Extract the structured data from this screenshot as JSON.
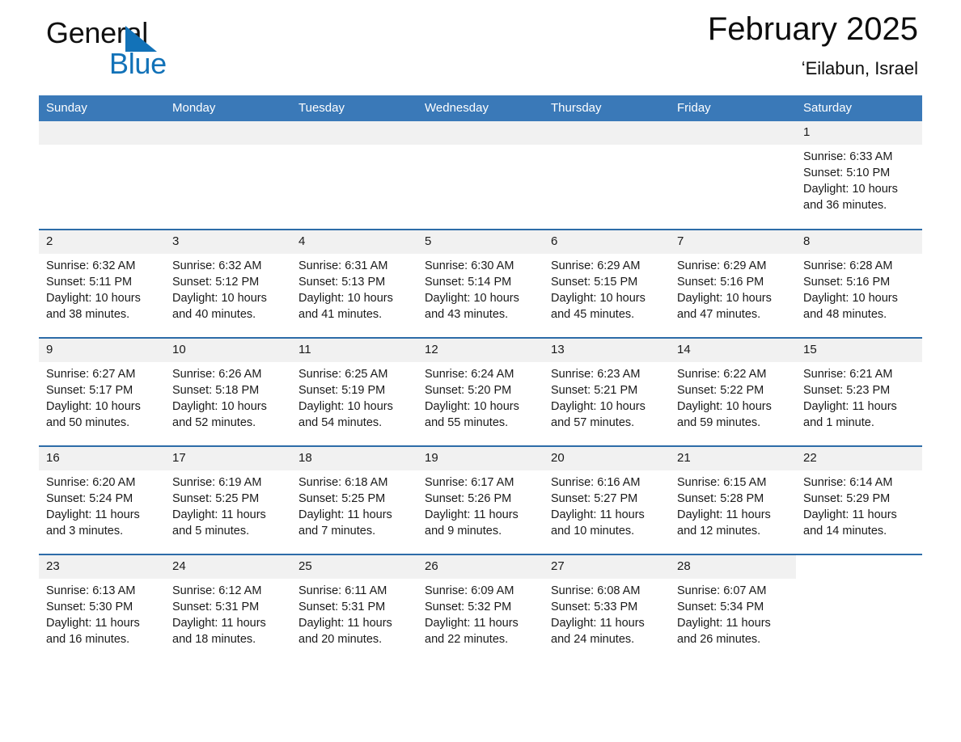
{
  "brand": {
    "word_one": "General",
    "word_two": "Blue",
    "triangle_icon": "brand-triangle-icon",
    "accent_color": "#1272b8"
  },
  "header": {
    "title": "February 2025",
    "subtitle": "ʻEilabun, Israel"
  },
  "theme": {
    "header_row_bg": "#3a79b8",
    "week_divider": "#2d6ca8",
    "daynum_bg": "#f1f1f1",
    "text": "#1a1a1a"
  },
  "weekday_headers": [
    "Sunday",
    "Monday",
    "Tuesday",
    "Wednesday",
    "Thursday",
    "Friday",
    "Saturday"
  ],
  "labels": {
    "sunrise_prefix": "Sunrise:",
    "sunset_prefix": "Sunset:",
    "daylight_prefix": "Daylight:"
  },
  "weeks": [
    [
      {
        "day": "",
        "sunrise": "",
        "sunset": "",
        "daylight": ""
      },
      {
        "day": "",
        "sunrise": "",
        "sunset": "",
        "daylight": ""
      },
      {
        "day": "",
        "sunrise": "",
        "sunset": "",
        "daylight": ""
      },
      {
        "day": "",
        "sunrise": "",
        "sunset": "",
        "daylight": ""
      },
      {
        "day": "",
        "sunrise": "",
        "sunset": "",
        "daylight": ""
      },
      {
        "day": "",
        "sunrise": "",
        "sunset": "",
        "daylight": ""
      },
      {
        "day": "1",
        "sunrise": "Sunrise: 6:33 AM",
        "sunset": "Sunset: 5:10 PM",
        "daylight": "Daylight: 10 hours and 36 minutes."
      }
    ],
    [
      {
        "day": "2",
        "sunrise": "Sunrise: 6:32 AM",
        "sunset": "Sunset: 5:11 PM",
        "daylight": "Daylight: 10 hours and 38 minutes."
      },
      {
        "day": "3",
        "sunrise": "Sunrise: 6:32 AM",
        "sunset": "Sunset: 5:12 PM",
        "daylight": "Daylight: 10 hours and 40 minutes."
      },
      {
        "day": "4",
        "sunrise": "Sunrise: 6:31 AM",
        "sunset": "Sunset: 5:13 PM",
        "daylight": "Daylight: 10 hours and 41 minutes."
      },
      {
        "day": "5",
        "sunrise": "Sunrise: 6:30 AM",
        "sunset": "Sunset: 5:14 PM",
        "daylight": "Daylight: 10 hours and 43 minutes."
      },
      {
        "day": "6",
        "sunrise": "Sunrise: 6:29 AM",
        "sunset": "Sunset: 5:15 PM",
        "daylight": "Daylight: 10 hours and 45 minutes."
      },
      {
        "day": "7",
        "sunrise": "Sunrise: 6:29 AM",
        "sunset": "Sunset: 5:16 PM",
        "daylight": "Daylight: 10 hours and 47 minutes."
      },
      {
        "day": "8",
        "sunrise": "Sunrise: 6:28 AM",
        "sunset": "Sunset: 5:16 PM",
        "daylight": "Daylight: 10 hours and 48 minutes."
      }
    ],
    [
      {
        "day": "9",
        "sunrise": "Sunrise: 6:27 AM",
        "sunset": "Sunset: 5:17 PM",
        "daylight": "Daylight: 10 hours and 50 minutes."
      },
      {
        "day": "10",
        "sunrise": "Sunrise: 6:26 AM",
        "sunset": "Sunset: 5:18 PM",
        "daylight": "Daylight: 10 hours and 52 minutes."
      },
      {
        "day": "11",
        "sunrise": "Sunrise: 6:25 AM",
        "sunset": "Sunset: 5:19 PM",
        "daylight": "Daylight: 10 hours and 54 minutes."
      },
      {
        "day": "12",
        "sunrise": "Sunrise: 6:24 AM",
        "sunset": "Sunset: 5:20 PM",
        "daylight": "Daylight: 10 hours and 55 minutes."
      },
      {
        "day": "13",
        "sunrise": "Sunrise: 6:23 AM",
        "sunset": "Sunset: 5:21 PM",
        "daylight": "Daylight: 10 hours and 57 minutes."
      },
      {
        "day": "14",
        "sunrise": "Sunrise: 6:22 AM",
        "sunset": "Sunset: 5:22 PM",
        "daylight": "Daylight: 10 hours and 59 minutes."
      },
      {
        "day": "15",
        "sunrise": "Sunrise: 6:21 AM",
        "sunset": "Sunset: 5:23 PM",
        "daylight": "Daylight: 11 hours and 1 minute."
      }
    ],
    [
      {
        "day": "16",
        "sunrise": "Sunrise: 6:20 AM",
        "sunset": "Sunset: 5:24 PM",
        "daylight": "Daylight: 11 hours and 3 minutes."
      },
      {
        "day": "17",
        "sunrise": "Sunrise: 6:19 AM",
        "sunset": "Sunset: 5:25 PM",
        "daylight": "Daylight: 11 hours and 5 minutes."
      },
      {
        "day": "18",
        "sunrise": "Sunrise: 6:18 AM",
        "sunset": "Sunset: 5:25 PM",
        "daylight": "Daylight: 11 hours and 7 minutes."
      },
      {
        "day": "19",
        "sunrise": "Sunrise: 6:17 AM",
        "sunset": "Sunset: 5:26 PM",
        "daylight": "Daylight: 11 hours and 9 minutes."
      },
      {
        "day": "20",
        "sunrise": "Sunrise: 6:16 AM",
        "sunset": "Sunset: 5:27 PM",
        "daylight": "Daylight: 11 hours and 10 minutes."
      },
      {
        "day": "21",
        "sunrise": "Sunrise: 6:15 AM",
        "sunset": "Sunset: 5:28 PM",
        "daylight": "Daylight: 11 hours and 12 minutes."
      },
      {
        "day": "22",
        "sunrise": "Sunrise: 6:14 AM",
        "sunset": "Sunset: 5:29 PM",
        "daylight": "Daylight: 11 hours and 14 minutes."
      }
    ],
    [
      {
        "day": "23",
        "sunrise": "Sunrise: 6:13 AM",
        "sunset": "Sunset: 5:30 PM",
        "daylight": "Daylight: 11 hours and 16 minutes."
      },
      {
        "day": "24",
        "sunrise": "Sunrise: 6:12 AM",
        "sunset": "Sunset: 5:31 PM",
        "daylight": "Daylight: 11 hours and 18 minutes."
      },
      {
        "day": "25",
        "sunrise": "Sunrise: 6:11 AM",
        "sunset": "Sunset: 5:31 PM",
        "daylight": "Daylight: 11 hours and 20 minutes."
      },
      {
        "day": "26",
        "sunrise": "Sunrise: 6:09 AM",
        "sunset": "Sunset: 5:32 PM",
        "daylight": "Daylight: 11 hours and 22 minutes."
      },
      {
        "day": "27",
        "sunrise": "Sunrise: 6:08 AM",
        "sunset": "Sunset: 5:33 PM",
        "daylight": "Daylight: 11 hours and 24 minutes."
      },
      {
        "day": "28",
        "sunrise": "Sunrise: 6:07 AM",
        "sunset": "Sunset: 5:34 PM",
        "daylight": "Daylight: 11 hours and 26 minutes."
      },
      {
        "day": "",
        "sunrise": "",
        "sunset": "",
        "daylight": ""
      }
    ]
  ]
}
